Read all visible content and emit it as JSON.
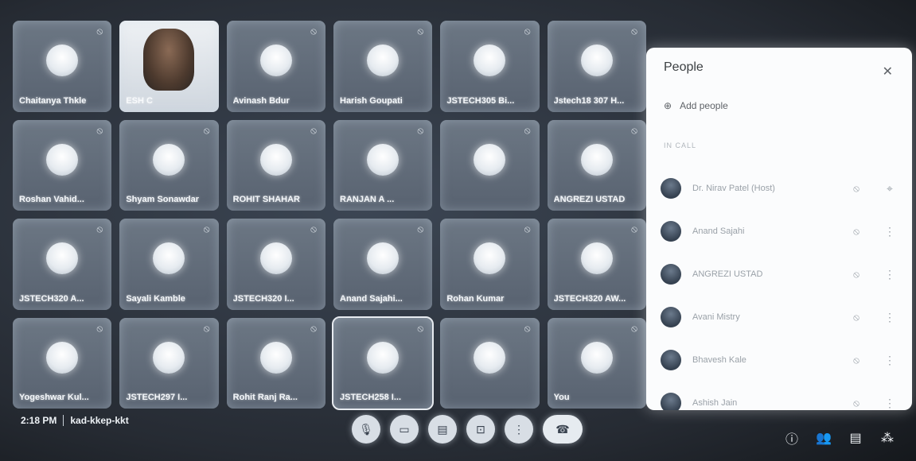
{
  "tiles": [
    {
      "name": "Chaitanya Thkle",
      "kind": "avatar"
    },
    {
      "name": "ESH C",
      "kind": "video"
    },
    {
      "name": "Avinash Bdur",
      "kind": "avatar"
    },
    {
      "name": "Harish Goupati",
      "kind": "avatar"
    },
    {
      "name": "JSTECH305 Bi...",
      "kind": "avatar"
    },
    {
      "name": "Jstech18 307 H...",
      "kind": "avatar"
    },
    {
      "name": "Roshan Vahid...",
      "kind": "avatar"
    },
    {
      "name": "Shyam Sonawdar",
      "kind": "avatar"
    },
    {
      "name": "ROHIT SHAHAR",
      "kind": "avatar"
    },
    {
      "name": "RANJAN A ...",
      "kind": "avatar"
    },
    {
      "name": "",
      "kind": "avatar"
    },
    {
      "name": "ANGREZI USTAD",
      "kind": "avatar"
    },
    {
      "name": "JSTECH320 A...",
      "kind": "avatar"
    },
    {
      "name": "Sayali Kamble",
      "kind": "avatar"
    },
    {
      "name": "JSTECH320 I...",
      "kind": "avatar"
    },
    {
      "name": "Anand Sajahi...",
      "kind": "avatar"
    },
    {
      "name": "Rohan Kumar",
      "kind": "avatar"
    },
    {
      "name": "JSTECH320 AW...",
      "kind": "avatar"
    },
    {
      "name": "Yogeshwar Kul...",
      "kind": "avatar"
    },
    {
      "name": "JSTECH297 I...",
      "kind": "avatar"
    },
    {
      "name": "Rohit Ranj Ra...",
      "kind": "avatar"
    },
    {
      "name": "JSTECH258 I...",
      "kind": "avatar"
    },
    {
      "name": "",
      "kind": "avatar"
    },
    {
      "name": "You",
      "kind": "avatar"
    }
  ],
  "meeting": {
    "time": "2:18 PM",
    "code": "kad-kkep-kkt"
  },
  "panel": {
    "title": "People",
    "add_people": "Add people",
    "section_label": "IN CALL",
    "people": [
      {
        "name": "Dr. Nirav Patel (Host)"
      },
      {
        "name": "Anand Sajahi"
      },
      {
        "name": "ANGREZI USTAD"
      },
      {
        "name": "Avani Mistry"
      },
      {
        "name": "Bhavesh Kale"
      },
      {
        "name": "Ashish Jain"
      }
    ]
  },
  "icons": {
    "mute": "mic-off-icon",
    "close": "close-icon",
    "add": "person-add-icon",
    "more": "more-vert-icon",
    "pin": "pin-icon"
  },
  "colors": {
    "panel_bg": "#fbfcfd",
    "stage_bg": "#262b33",
    "tile_bg": "#6c7784"
  }
}
